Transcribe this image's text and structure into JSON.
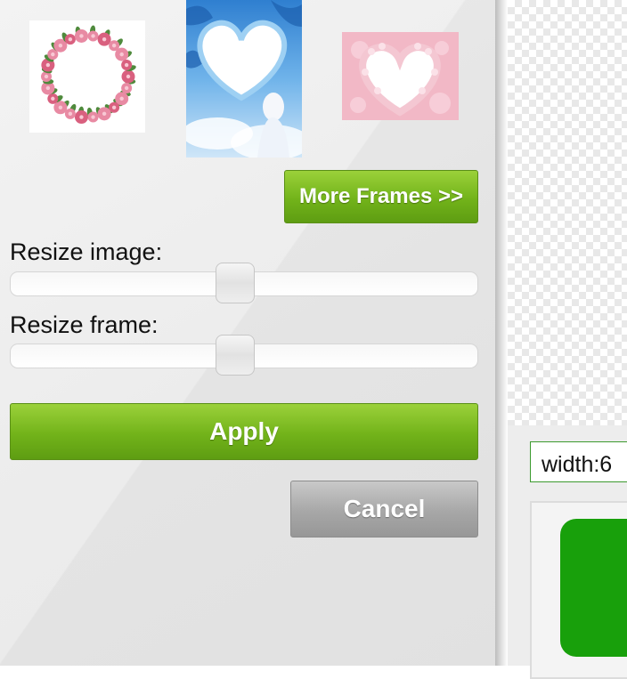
{
  "frames": [
    {
      "name": "flower-wreath"
    },
    {
      "name": "blue-heart-angel"
    },
    {
      "name": "pink-rose-heart"
    }
  ],
  "buttons": {
    "more_frames": "More Frames >>",
    "apply": "Apply",
    "cancel": "Cancel"
  },
  "sliders": {
    "resize_image": {
      "label": "Resize image:",
      "value_fraction": 0.48
    },
    "resize_frame": {
      "label": "Resize frame:",
      "value_fraction": 0.48
    }
  },
  "right_panel": {
    "width_value": "width:6"
  },
  "colors": {
    "green_button": "#72b31a",
    "gray_button": "#a7a7a7",
    "accent_green": "#18a00b"
  }
}
